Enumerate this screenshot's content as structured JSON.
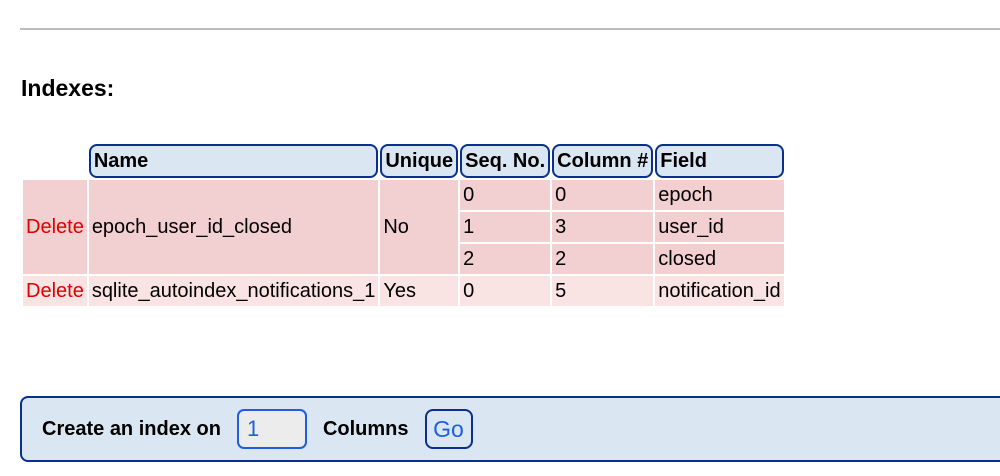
{
  "section": {
    "title": "Indexes:"
  },
  "table": {
    "headers": [
      "Name",
      "Unique",
      "Seq. No.",
      "Column #",
      "Field"
    ],
    "indexes": [
      {
        "action": "Delete",
        "name": "epoch_user_id_closed",
        "unique": "No",
        "columns": [
          {
            "seq": "0",
            "col": "0",
            "field": "epoch"
          },
          {
            "seq": "1",
            "col": "3",
            "field": "user_id"
          },
          {
            "seq": "2",
            "col": "2",
            "field": "closed"
          }
        ]
      },
      {
        "action": "Delete",
        "name": "sqlite_autoindex_notifications_1",
        "unique": "Yes",
        "columns": [
          {
            "seq": "0",
            "col": "5",
            "field": "notification_id"
          }
        ]
      }
    ]
  },
  "create_index": {
    "label": "Create an index on",
    "columns_value": "1",
    "columns_label": "Columns",
    "go_label": "Go"
  },
  "colors": {
    "delete_link": "#e00000",
    "header_bg": "#dbe6f3",
    "header_border": "#0a2f8c",
    "row_alt_1": "#f2cfd0",
    "row_alt_2": "#f9e3e3"
  }
}
